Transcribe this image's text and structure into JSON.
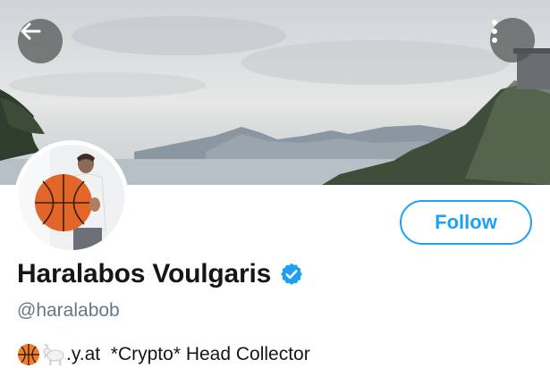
{
  "header": {
    "back_icon": "arrow-left-icon",
    "more_icon": "vertical-dots-icon",
    "banner": "landscape-lake-mountains"
  },
  "profile": {
    "avatar": "avatar-person-with-basketball",
    "display_name": "Haralabos Voulgaris",
    "verified_icon": "verified-badge-icon",
    "handle": "@haralabob",
    "bio": {
      "emojis": [
        "basketball-emoji",
        "goat-emoji"
      ],
      "text": ".y.at  *Crypto* Head Collector"
    },
    "follow_label": "Follow"
  },
  "colors": {
    "accent": "#1da1f2",
    "name": "#14171a",
    "handle": "#657786",
    "icon_button_bg": "#505050"
  }
}
